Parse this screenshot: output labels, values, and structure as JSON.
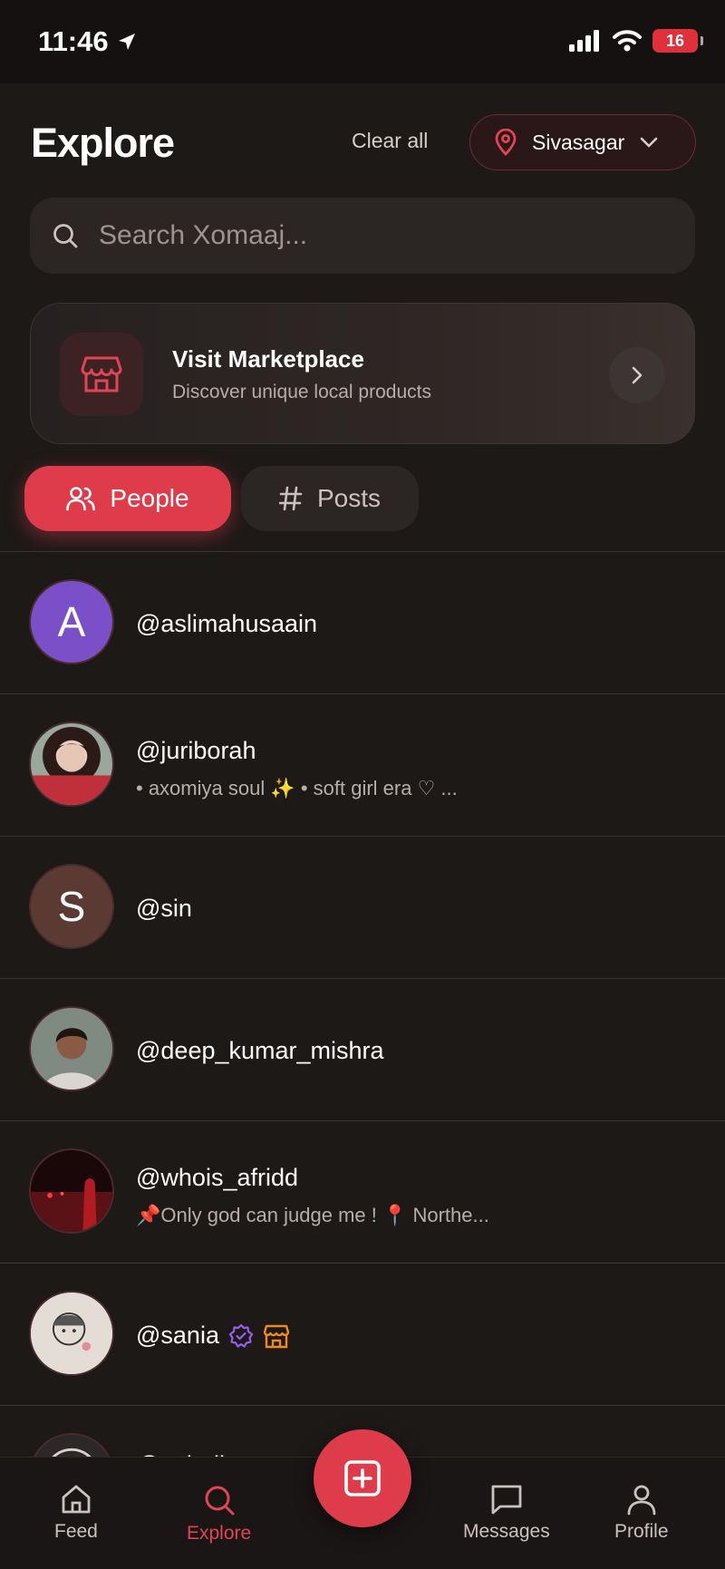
{
  "status_bar": {
    "time": "11:46",
    "battery": "16"
  },
  "header": {
    "title": "Explore",
    "clear_all": "Clear all",
    "location": "Sivasagar"
  },
  "search": {
    "placeholder": "Search Xomaaj..."
  },
  "marketplace": {
    "title": "Visit Marketplace",
    "subtitle": "Discover unique local products"
  },
  "tabs": [
    {
      "label": "People",
      "active": true
    },
    {
      "label": "Posts",
      "active": false
    }
  ],
  "users": [
    {
      "username": "@aslimahusaain",
      "initial": "A",
      "avatar_color": "#7a4fc8",
      "bio": ""
    },
    {
      "username": "@juriborah",
      "initial": "",
      "avatar_color": "#c9b7b0",
      "bio": "• axomiya soul ✨ • soft girl era ♡ ..."
    },
    {
      "username": "@sin",
      "initial": "S",
      "avatar_color": "#5b3a33",
      "bio": ""
    },
    {
      "username": "@deep_kumar_mishra",
      "initial": "",
      "avatar_color": "#6f7a72",
      "bio": ""
    },
    {
      "username": "@whois_afridd",
      "initial": "",
      "avatar_color": "#3a0f12",
      "bio": "📌Only god can judge me ! 📍 Northe..."
    },
    {
      "username": "@sania",
      "initial": "",
      "avatar_color": "#e4ddd6",
      "bio": "",
      "verified": true,
      "seller": true
    },
    {
      "username": "@snigdha",
      "initial": "",
      "avatar_color": "#2c2827",
      "bio": ""
    }
  ],
  "nav": [
    {
      "label": "Feed",
      "icon": "home-icon"
    },
    {
      "label": "Explore",
      "icon": "search-icon",
      "active": true
    },
    {
      "label": "Messages",
      "icon": "message-icon"
    },
    {
      "label": "Profile",
      "icon": "user-icon"
    }
  ],
  "colors": {
    "accent": "#de3b4b",
    "background": "#1d1917",
    "verified": "#9b5cf0",
    "seller": "#f08a1c"
  }
}
